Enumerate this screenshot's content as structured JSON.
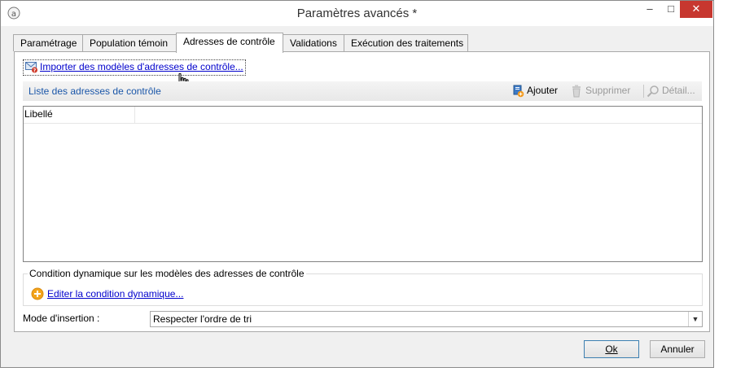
{
  "window": {
    "title": "Paramètres avancés *",
    "minimize": "–",
    "maximize": "□",
    "close": "✕"
  },
  "tabs": [
    {
      "label": "Paramétrage"
    },
    {
      "label": "Population témoin"
    },
    {
      "label": "Adresses de contrôle",
      "active": true
    },
    {
      "label": "Validations"
    },
    {
      "label": "Exécution des traitements"
    }
  ],
  "import_link": "Importer des modèles d'adresses de contrôle...",
  "list": {
    "title": "Liste des adresses de contrôle",
    "toolbar": {
      "add": "Ajouter",
      "delete": "Supprimer",
      "detail": "Détail..."
    },
    "columns": [
      "Libellé"
    ]
  },
  "dynamic_condition": {
    "legend": "Condition dynamique sur les modèles des adresses de contrôle",
    "link": "Editer la condition dynamique..."
  },
  "insertion_mode": {
    "label": "Mode d'insertion :",
    "value": "Respecter l'ordre de tri"
  },
  "buttons": {
    "ok": "Ok",
    "cancel": "Annuler"
  }
}
